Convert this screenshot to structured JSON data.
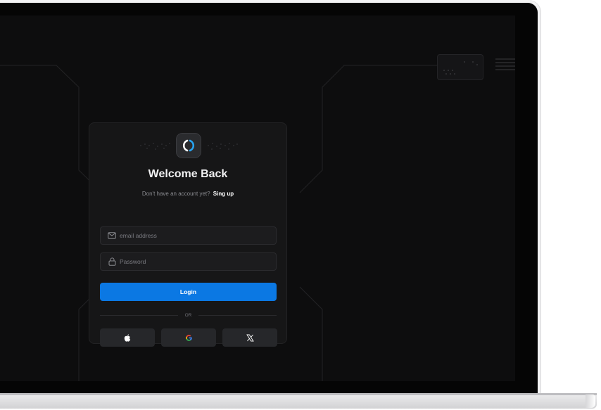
{
  "card": {
    "title": "Welcome Back",
    "subtitle_text": "Don't have an account yet?",
    "signup_link": "Sing up"
  },
  "form": {
    "email_placeholder": "email address",
    "password_placeholder": "Password",
    "login_label": "Login",
    "divider_label": "OR"
  },
  "social": {
    "apple": "apple-icon",
    "google": "google-icon",
    "x": "x-icon"
  },
  "colors": {
    "accent": "#0b78e3",
    "background": "#0d0d0e",
    "card": "#161617"
  }
}
